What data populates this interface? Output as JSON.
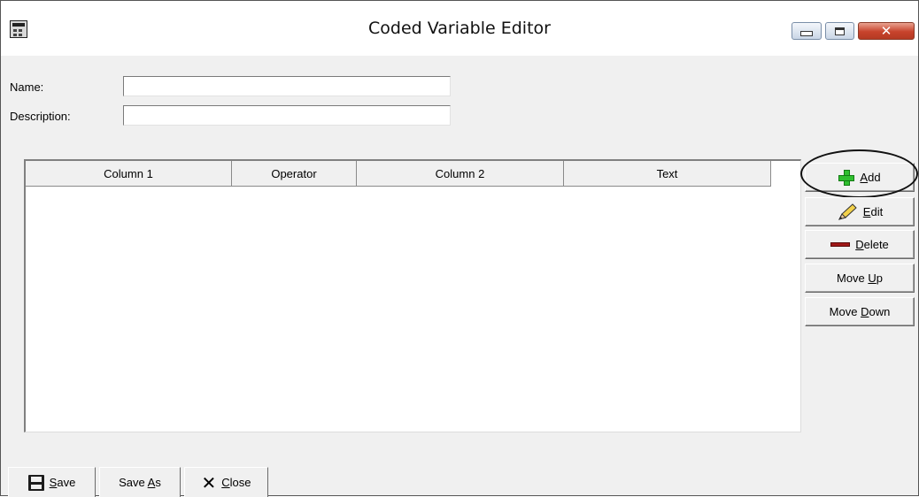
{
  "window": {
    "title": "Coded Variable Editor",
    "controls": {
      "minimize": "minimize-icon",
      "maximize": "maximize-icon",
      "close": "close-icon"
    }
  },
  "form": {
    "name_label": "Name:",
    "name_value": "",
    "description_label": "Description:",
    "description_value": ""
  },
  "grid": {
    "columns": [
      "Column 1",
      "Operator",
      "Column 2",
      "Text"
    ],
    "rows": []
  },
  "side_buttons": {
    "add": {
      "pre": "",
      "key": "A",
      "post": "dd",
      "icon": "plus-icon",
      "icon_color": "#2fbf2f"
    },
    "edit": {
      "pre": "",
      "key": "E",
      "post": "dit",
      "icon": "pencil-icon"
    },
    "delete": {
      "pre": "",
      "key": "D",
      "post": "elete",
      "icon": "minus-icon",
      "icon_color": "#a01818"
    },
    "move_up": {
      "pre": "Move ",
      "key": "U",
      "post": "p"
    },
    "move_down": {
      "pre": "Move ",
      "key": "D",
      "post": "own"
    }
  },
  "bottom_buttons": {
    "save": {
      "pre": "",
      "key": "S",
      "post": "ave",
      "icon": "floppy-disk-icon"
    },
    "save_as": {
      "pre": "Save ",
      "key": "A",
      "post": "s"
    },
    "close": {
      "pre": "",
      "key": "C",
      "post": "lose",
      "icon": "x-icon"
    }
  },
  "colors": {
    "window_bg": "#f0f0f0",
    "close_button": "#c7432c",
    "annotation_oval": "#111111"
  }
}
